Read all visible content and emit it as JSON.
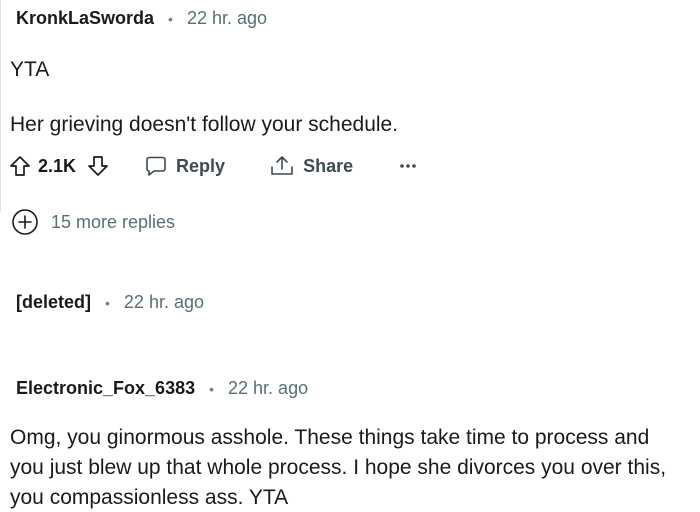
{
  "comments": [
    {
      "author": "KronkLaSworda",
      "separator": "•",
      "time": "22 hr. ago",
      "lines": [
        "YTA",
        "Her grieving doesn't follow your schedule."
      ],
      "actions": {
        "upvote_icon": "upvote-arrow-icon",
        "votes": "2.1K",
        "downvote_icon": "downvote-arrow-icon",
        "reply_label": "Reply",
        "reply_icon": "speech-bubble-icon",
        "share_label": "Share",
        "share_icon": "share-arrow-icon",
        "more_label": "···",
        "more_icon": "more-options-icon"
      },
      "more_replies": {
        "icon": "plus-circle-icon",
        "label": "15 more replies"
      }
    },
    {
      "author": "[deleted]",
      "separator": "•",
      "time": "22 hr. ago"
    },
    {
      "author": "Electronic_Fox_6383",
      "separator": "•",
      "time": "22 hr. ago",
      "lines": [
        "Omg, you ginormous asshole. These things take time to process and",
        "you just blew up that whole process. I hope she divorces you over this,",
        "you compassionless ass. YTA"
      ]
    }
  ],
  "colors": {
    "text": "#1a1a1b",
    "meta": "#576f76",
    "action": "#3d4a4f",
    "thread_line": "#e0e3e6"
  }
}
